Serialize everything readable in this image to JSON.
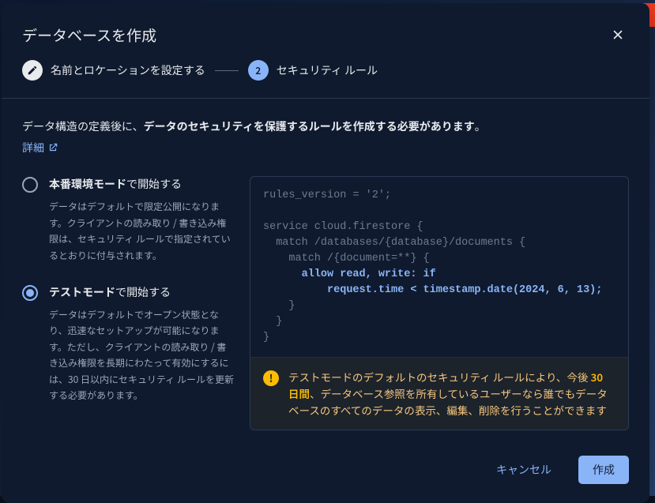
{
  "modal": {
    "title": "データベースを作成",
    "steps": {
      "step1_label": "名前とロケーションを設定する",
      "step2_num": "2",
      "step2_label": "セキュリティ ルール"
    },
    "intro_prefix": "データ構造の定義後に、",
    "intro_bold": "データのセキュリティを保護するルールを作成する必要があります",
    "intro_suffix": "。",
    "learn_more": "詳細",
    "modes": {
      "prod": {
        "label_strong": "本番環境モード",
        "label_rest": "で開始する",
        "desc": "データはデフォルトで限定公開になります。クライアントの読み取り / 書き込み権限は、セキュリティ ルールで指定されているとおりに付与されます。"
      },
      "test": {
        "label_strong": "テストモード",
        "label_rest": "で開始する",
        "desc": "データはデフォルトでオープン状態となり、迅速なセットアップが可能になります。ただし、クライアントの読み取り / 書き込み権限を長期にわたって有効にするには、30 日以内にセキュリティ ルールを更新する必要があります。"
      }
    },
    "rules_code": {
      "l1": "rules_version = '2';",
      "l2": "",
      "l3": "service cloud.firestore {",
      "l4": "  match /databases/{database}/documents {",
      "l5": "    match /{document=**} {",
      "l6a": "      ",
      "l6b": "allow read, write: if",
      "l7a": "          ",
      "l7b": "request.time < timestamp.date(2024, 6, 13);",
      "l8": "    }",
      "l9": "  }",
      "l10": "}"
    },
    "warning": {
      "pre": "テストモードのデフォルトのセキュリティ ルールにより、今後 ",
      "period": "30 日間",
      "post": "、データベース参照を所有しているユーザーなら誰でもデータベースのすべてのデータの表示、編集、削除を行うことができます"
    },
    "footer": {
      "cancel": "キャンセル",
      "create": "作成"
    }
  }
}
